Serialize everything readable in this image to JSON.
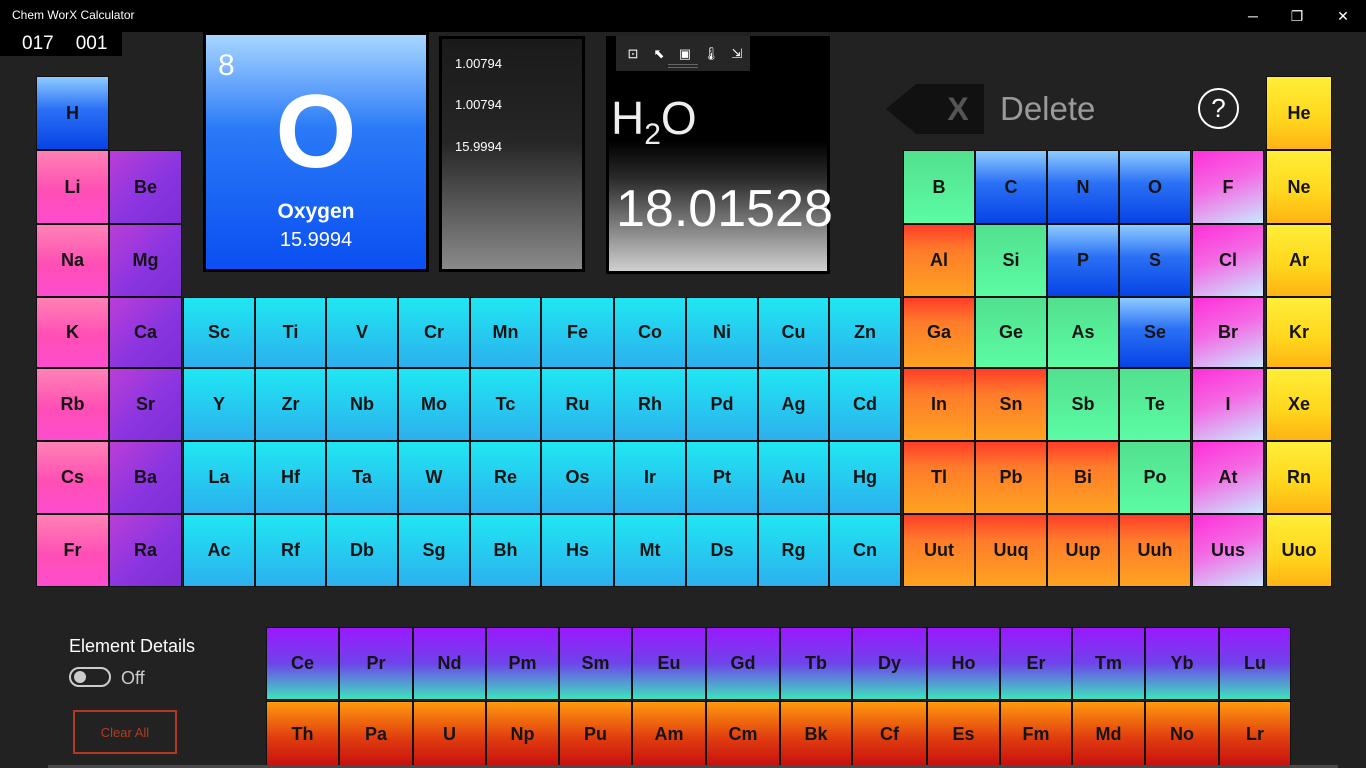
{
  "window": {
    "title": "Chem WorX Calculator",
    "controls": {
      "minimize": "─",
      "restore": "❐",
      "close": "✕"
    }
  },
  "counters": {
    "left": "017",
    "right": "001"
  },
  "selected_element": {
    "number": "8",
    "symbol": "O",
    "name": "Oxygen",
    "mass": "15.9994"
  },
  "mass_list": [
    "1.00794",
    "1.00794",
    "15.9994"
  ],
  "result": {
    "formula_symbol_1": "H",
    "formula_subscript": "2",
    "formula_symbol_2": "O",
    "molar_mass": "18.01528"
  },
  "toolbar_icons": [
    "select-area-icon",
    "pointer-icon",
    "frame-icon",
    "thermometer-icon",
    "export-icon"
  ],
  "toolbar_glyphs": [
    "⊡",
    "⬉",
    "▣",
    "🌡",
    "⇲"
  ],
  "delete": {
    "x_glyph": "X",
    "label": "Delete"
  },
  "help": {
    "label": "?"
  },
  "element_details": {
    "label": "Element Details",
    "state": "Off"
  },
  "clear_all": {
    "label": "Clear All"
  },
  "elements": {
    "H": "H",
    "Li": "Li",
    "Be": "Be",
    "Na": "Na",
    "Mg": "Mg",
    "K": "K",
    "Ca": "Ca",
    "Rb": "Rb",
    "Sr": "Sr",
    "Cs": "Cs",
    "Ba": "Ba",
    "Fr": "Fr",
    "Ra": "Ra",
    "transition": [
      [
        "Sc",
        "Ti",
        "V",
        "Cr",
        "Mn",
        "Fe",
        "Co",
        "Ni",
        "Cu",
        "Zn"
      ],
      [
        "Y",
        "Zr",
        "Nb",
        "Mo",
        "Tc",
        "Ru",
        "Rh",
        "Pd",
        "Ag",
        "Cd"
      ],
      [
        "La",
        "Hf",
        "Ta",
        "W",
        "Re",
        "Os",
        "Ir",
        "Pt",
        "Au",
        "Hg"
      ],
      [
        "Ac",
        "Rf",
        "Db",
        "Sg",
        "Bh",
        "Hs",
        "Mt",
        "Ds",
        "Rg",
        "Cn"
      ]
    ],
    "p_block": [
      [
        "B",
        "C",
        "N",
        "O",
        "F",
        "Ne"
      ],
      [
        "Al",
        "Si",
        "P",
        "S",
        "Cl",
        "Ar"
      ],
      [
        "Ga",
        "Ge",
        "As",
        "Se",
        "Br",
        "Kr"
      ],
      [
        "In",
        "Sn",
        "Sb",
        "Te",
        "I",
        "Xe"
      ],
      [
        "Tl",
        "Pb",
        "Bi",
        "Po",
        "At",
        "Rn"
      ],
      [
        "Uut",
        "Uuq",
        "Uup",
        "Uuh",
        "Uus",
        "Uuo"
      ]
    ],
    "He": "He",
    "lanthanides": [
      "Ce",
      "Pr",
      "Nd",
      "Pm",
      "Sm",
      "Eu",
      "Gd",
      "Tb",
      "Dy",
      "Ho",
      "Er",
      "Tm",
      "Yb",
      "Lu"
    ],
    "actinides": [
      "Th",
      "Pa",
      "U",
      "Np",
      "Pu",
      "Am",
      "Cm",
      "Bk",
      "Cf",
      "Es",
      "Fm",
      "Md",
      "No",
      "Lr"
    ]
  },
  "colors": {
    "p_block_categories": [
      [
        "green",
        "blue",
        "blue",
        "blue",
        "magenta",
        "yellow"
      ],
      [
        "orange",
        "green",
        "blue",
        "blue",
        "magenta",
        "yellow"
      ],
      [
        "orange",
        "green",
        "green",
        "blue",
        "magenta",
        "yellow"
      ],
      [
        "orange",
        "orange",
        "green",
        "green",
        "magenta",
        "yellow"
      ],
      [
        "orange",
        "orange",
        "orange",
        "green",
        "magenta",
        "yellow"
      ],
      [
        "orange",
        "orange",
        "orange",
        "orange",
        "magenta",
        "yellow"
      ]
    ]
  }
}
